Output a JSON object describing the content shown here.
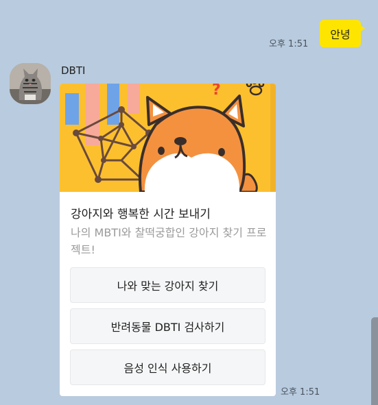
{
  "me": {
    "time": "오후 1:51",
    "message": "안녕"
  },
  "bot": {
    "name": "DBTI",
    "time": "오후 1:51",
    "card": {
      "title": "강아지와 행복한 시간 보내기",
      "description": "나의 MBTI와 찰떡궁합인 강아지 찾기 프로젝트!",
      "buttons": [
        "나와 맞는 강아지 찾기",
        "반려동물 DBTI 검사하기",
        "음성 인식 사용하기"
      ]
    }
  },
  "colors": {
    "background": "#b9cbde",
    "my_bubble": "#fee500",
    "banner": "#fcc02e"
  },
  "icons": {
    "avatar": "cat-photo",
    "banner": "shiba-dog-illustration"
  }
}
